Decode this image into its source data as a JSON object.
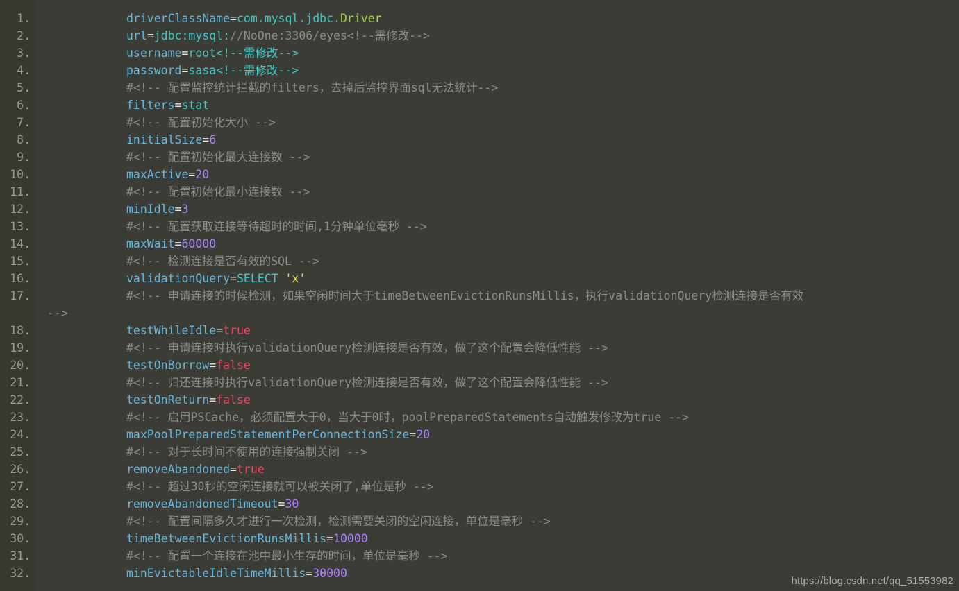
{
  "editor": {
    "background_color": "#3b3c36",
    "gutter_color": "#37382f",
    "line_number_color": "#9b9b93",
    "first_line": 1,
    "last_line": 32,
    "total_lines": 32,
    "language": "properties"
  },
  "colors": {
    "key": "#63b8e0",
    "equals": "#e8e8e2",
    "value": "#3fc7c7",
    "number": "#ae81ff",
    "boolean": "#f4425f",
    "string": "#e6db5a",
    "classname": "#9fd13a",
    "comment": "#8d8d85"
  },
  "watermark": {
    "text": "https://blog.csdn.net/qq_51553982"
  },
  "lines": [
    {
      "n": "1.",
      "tokens": [
        {
          "t": "key",
          "s": "driverClassName"
        },
        {
          "t": "eq",
          "s": "="
        },
        {
          "t": "val",
          "s": "com.mysql.jdbc."
        },
        {
          "t": "class",
          "s": "Driver"
        }
      ]
    },
    {
      "n": "2.",
      "tokens": [
        {
          "t": "key",
          "s": "url"
        },
        {
          "t": "eq",
          "s": "="
        },
        {
          "t": "val",
          "s": "jdbc:mysql:"
        },
        {
          "t": "comment",
          "s": "//NoOne:3306/eyes<!--需修改-->"
        }
      ]
    },
    {
      "n": "3.",
      "tokens": [
        {
          "t": "key",
          "s": "username"
        },
        {
          "t": "eq",
          "s": "="
        },
        {
          "t": "val",
          "s": "root<!--需修改-->"
        }
      ]
    },
    {
      "n": "4.",
      "tokens": [
        {
          "t": "key",
          "s": "password"
        },
        {
          "t": "eq",
          "s": "="
        },
        {
          "t": "val",
          "s": "sasa<!--需修改-->"
        }
      ]
    },
    {
      "n": "5.",
      "tokens": [
        {
          "t": "comment",
          "s": "#<!-- 配置监控统计拦截的filters，去掉后监控界面sql无法统计-->"
        }
      ]
    },
    {
      "n": "6.",
      "tokens": [
        {
          "t": "key",
          "s": "filters"
        },
        {
          "t": "eq",
          "s": "="
        },
        {
          "t": "val",
          "s": "stat"
        }
      ]
    },
    {
      "n": "7.",
      "tokens": [
        {
          "t": "comment",
          "s": "#<!-- 配置初始化大小 -->"
        }
      ]
    },
    {
      "n": "8.",
      "tokens": [
        {
          "t": "key",
          "s": "initialSize"
        },
        {
          "t": "eq",
          "s": "="
        },
        {
          "t": "num",
          "s": "6"
        }
      ]
    },
    {
      "n": "9.",
      "tokens": [
        {
          "t": "comment",
          "s": "#<!-- 配置初始化最大连接数 -->"
        }
      ]
    },
    {
      "n": "10.",
      "tokens": [
        {
          "t": "key",
          "s": "maxActive"
        },
        {
          "t": "eq",
          "s": "="
        },
        {
          "t": "num",
          "s": "20"
        }
      ]
    },
    {
      "n": "11.",
      "tokens": [
        {
          "t": "comment",
          "s": "#<!-- 配置初始化最小连接数 -->"
        }
      ]
    },
    {
      "n": "12.",
      "tokens": [
        {
          "t": "key",
          "s": "minIdle"
        },
        {
          "t": "eq",
          "s": "="
        },
        {
          "t": "num",
          "s": "3"
        }
      ]
    },
    {
      "n": "13.",
      "tokens": [
        {
          "t": "comment",
          "s": "#<!-- 配置获取连接等待超时的时间,1分钟单位毫秒 -->"
        }
      ]
    },
    {
      "n": "14.",
      "tokens": [
        {
          "t": "key",
          "s": "maxWait"
        },
        {
          "t": "eq",
          "s": "="
        },
        {
          "t": "num",
          "s": "60000"
        }
      ]
    },
    {
      "n": "15.",
      "tokens": [
        {
          "t": "comment",
          "s": "#<!-- 检测连接是否有效的SQL -->"
        }
      ]
    },
    {
      "n": "16.",
      "tokens": [
        {
          "t": "key",
          "s": "validationQuery"
        },
        {
          "t": "eq",
          "s": "="
        },
        {
          "t": "val",
          "s": "SELECT "
        },
        {
          "t": "str",
          "s": "'x'"
        }
      ]
    },
    {
      "n": "17.",
      "tokens": [
        {
          "t": "comment",
          "s": "#<!-- 申请连接的时候检测，如果空闲时间大于timeBetweenEvictionRunsMillis，执行validationQuery检测连接是否有效"
        }
      ],
      "wrap": "-->"
    },
    {
      "n": "18.",
      "tokens": [
        {
          "t": "key",
          "s": "testWhileIdle"
        },
        {
          "t": "eq",
          "s": "="
        },
        {
          "t": "bool",
          "s": "true"
        }
      ]
    },
    {
      "n": "19.",
      "tokens": [
        {
          "t": "comment",
          "s": "#<!-- 申请连接时执行validationQuery检测连接是否有效，做了这个配置会降低性能 -->"
        }
      ]
    },
    {
      "n": "20.",
      "tokens": [
        {
          "t": "key",
          "s": "testOnBorrow"
        },
        {
          "t": "eq",
          "s": "="
        },
        {
          "t": "bool",
          "s": "false"
        }
      ]
    },
    {
      "n": "21.",
      "tokens": [
        {
          "t": "comment",
          "s": "#<!-- 归还连接时执行validationQuery检测连接是否有效，做了这个配置会降低性能 -->"
        }
      ]
    },
    {
      "n": "22.",
      "tokens": [
        {
          "t": "key",
          "s": "testOnReturn"
        },
        {
          "t": "eq",
          "s": "="
        },
        {
          "t": "bool",
          "s": "false"
        }
      ]
    },
    {
      "n": "23.",
      "tokens": [
        {
          "t": "comment",
          "s": "#<!-- 启用PSCache，必须配置大于0，当大于0时，poolPreparedStatements自动触发修改为true -->"
        }
      ]
    },
    {
      "n": "24.",
      "tokens": [
        {
          "t": "key",
          "s": "maxPoolPreparedStatementPerConnectionSize"
        },
        {
          "t": "eq",
          "s": "="
        },
        {
          "t": "num",
          "s": "20"
        }
      ]
    },
    {
      "n": "25.",
      "tokens": [
        {
          "t": "comment",
          "s": "#<!-- 对于长时间不使用的连接强制关闭 -->"
        }
      ]
    },
    {
      "n": "26.",
      "tokens": [
        {
          "t": "key",
          "s": "removeAbandoned"
        },
        {
          "t": "eq",
          "s": "="
        },
        {
          "t": "bool",
          "s": "true"
        }
      ]
    },
    {
      "n": "27.",
      "tokens": [
        {
          "t": "comment",
          "s": "#<!-- 超过30秒的空闲连接就可以被关闭了,单位是秒 -->"
        }
      ]
    },
    {
      "n": "28.",
      "tokens": [
        {
          "t": "key",
          "s": "removeAbandonedTimeout"
        },
        {
          "t": "eq",
          "s": "="
        },
        {
          "t": "num",
          "s": "30"
        }
      ]
    },
    {
      "n": "29.",
      "tokens": [
        {
          "t": "comment",
          "s": "#<!-- 配置间隔多久才进行一次检测，检测需要关闭的空闲连接，单位是毫秒 -->"
        }
      ]
    },
    {
      "n": "30.",
      "tokens": [
        {
          "t": "key",
          "s": "timeBetweenEvictionRunsMillis"
        },
        {
          "t": "eq",
          "s": "="
        },
        {
          "t": "num",
          "s": "10000"
        }
      ]
    },
    {
      "n": "31.",
      "tokens": [
        {
          "t": "comment",
          "s": "#<!-- 配置一个连接在池中最小生存的时间，单位是毫秒 -->"
        }
      ]
    },
    {
      "n": "32.",
      "tokens": [
        {
          "t": "key",
          "s": "minEvictableIdleTimeMillis"
        },
        {
          "t": "eq",
          "s": "="
        },
        {
          "t": "num",
          "s": "30000"
        }
      ]
    }
  ]
}
